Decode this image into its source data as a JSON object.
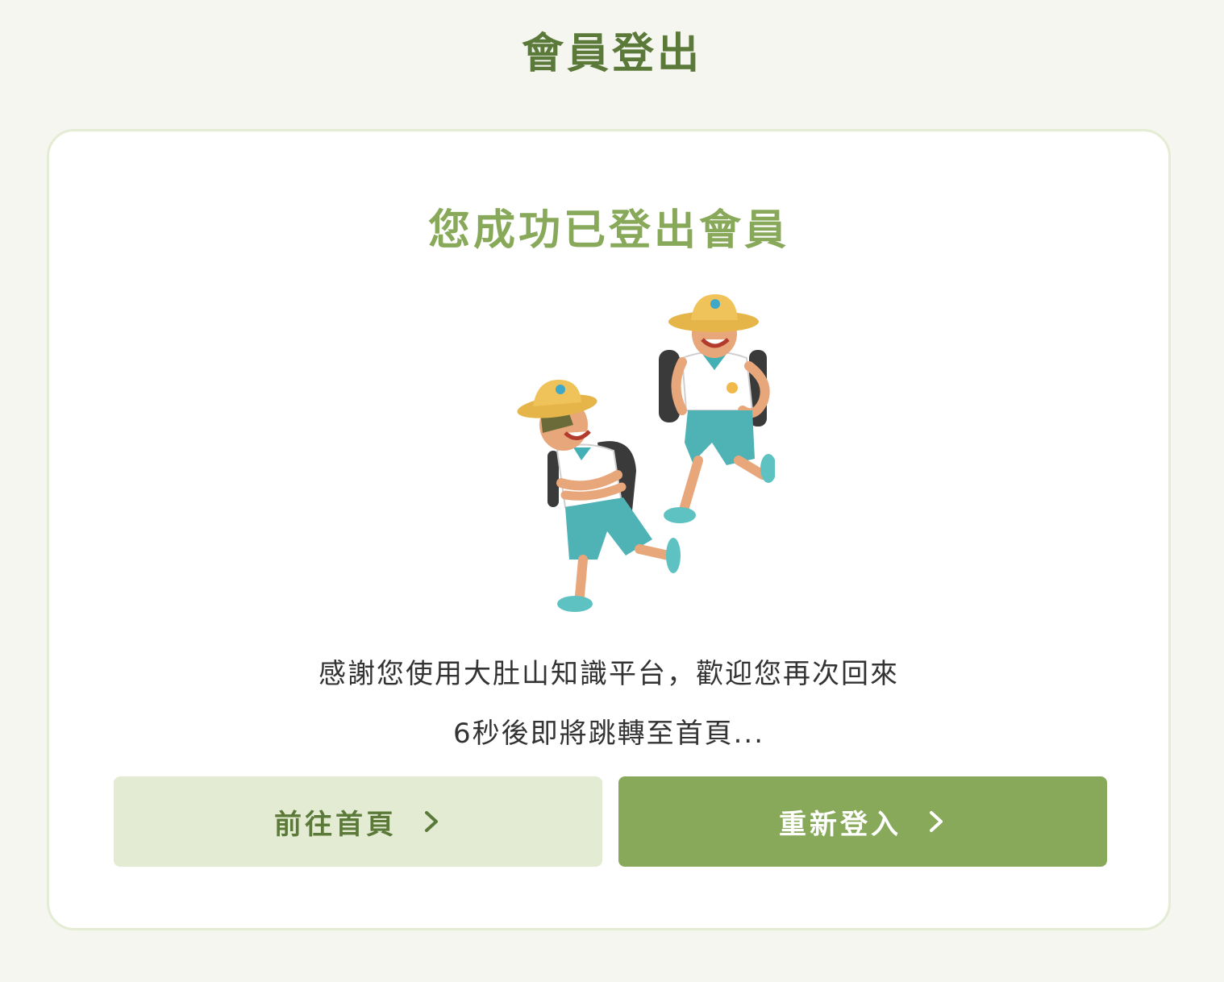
{
  "page": {
    "title": "會員登出"
  },
  "card": {
    "title": "您成功已登出會員",
    "illustration_icon": "two-students-running-illustration",
    "message": "感謝您使用大肚山知識平台，歡迎您再次回來",
    "countdown": "6秒後即將跳轉至首頁..."
  },
  "buttons": {
    "home_label": "前往首頁",
    "relogin_label": "重新登入",
    "chevron_icon": "chevron-right-icon"
  },
  "colors": {
    "background": "#f4f6ef",
    "title_green": "#5b7a3a",
    "accent_green": "#88a95a",
    "light_green": "#e3ecd3",
    "card_border": "#e4ecd4"
  }
}
